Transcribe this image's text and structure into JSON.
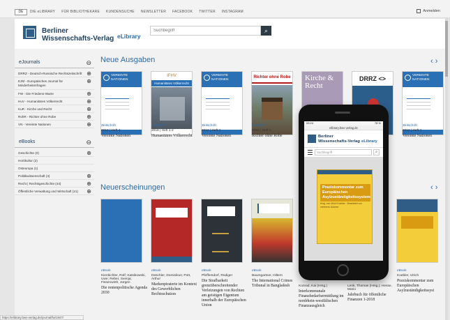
{
  "topbar": {
    "lang": "DE",
    "nav": [
      "DIE eLIBRARY",
      "FÜR BIBLIOTHEKARE",
      "KUNDENSUCHE",
      "NEWSLETTER",
      "FACEBOOK",
      "TWITTER",
      "INSTAGRAM"
    ],
    "login": "Anmelden"
  },
  "header": {
    "brand_line1": "Berliner",
    "brand_line2": "Wissenschafts-Verlag",
    "elibrary": "eLibrary",
    "search_placeholder": "Suchbegriff"
  },
  "sidebar": {
    "ejournals_title": "eJournals",
    "ejournals": [
      "DRRZ - Deutsch-Russische Rechtszeitschrift",
      "EJM - Europäisches Journal für Minderheitenfragen",
      "FW - Die Friedens-Warte",
      "HuV - Humanitäres Völkerrecht",
      "KuR - Kirche und Recht",
      "RohR - Richter ohne Robe",
      "VN - Vereinte Nationen"
    ],
    "ebooks_title": "eBooks",
    "ebooks": [
      "Geschichte (0)",
      "Hortikultur (2)",
      "Osteuropa (1)",
      "Politikwissenschaft (4)",
      "Recht | Rechtsgeschichte (44)",
      "Öffentliche Verwaltung und Wirtschaft (21)"
    ]
  },
  "neue_ausgaben": {
    "title": "Neue Ausgaben",
    "items": [
      {
        "kind": "Zeitschrift",
        "issue": "2018 | Heft 4",
        "name": "Vereinte Nationen"
      },
      {
        "kind": "Zeitschrift",
        "issue": "2018 | Heft 1-2",
        "name": "Humanitäres Völkerrecht"
      },
      {
        "kind": "Zeitschrift",
        "issue": "2018 | Heft 1",
        "name": "Vereinte Nationen"
      },
      {
        "kind": "Zeitschrift",
        "issue": "2018 | Heft 1",
        "name": "Richter ohne Robe"
      },
      {
        "kind": "Zeitschrift",
        "issue": "2018 | Heft 1",
        "name": "Vereinte Nationen"
      }
    ]
  },
  "neuerscheinungen": {
    "title": "Neuerscheinungen",
    "items": [
      {
        "kind": "eBook",
        "authors": "Kienbichler, Rolf; Katsikowski, Uwe; Reber, Svenja; Fissenwirth, Jürgen",
        "name": "Die rentenpolitische Agenda 2030"
      },
      {
        "kind": "eBook",
        "authors": "Deschler, Dominikus; Pott, Arthur",
        "name": "Markenpiraterie im Kontext des Gewerblichen Rechtsschutzes"
      },
      {
        "kind": "eBook",
        "authors": "Pfeffersdorf, Rüdiger",
        "name": "Die Strafbarkeit grenzüberschreitender Verletzungen von Rechten am geistigen Eigentum innerhalb der Europäischen Union"
      },
      {
        "kind": "eBook",
        "authors": "Baumgartner, Hiltern",
        "name": "The International Crimes Tribunal in Bangladesh"
      },
      {
        "kind": "eBook",
        "authors": "Konrad, Kai (Hrsg.)",
        "name": "Interkommunale Finanzbedarfsermittlung im nordrhein-westfälischen Finanzausgleich"
      },
      {
        "kind": "eBook",
        "authors": "Lenk, Thomas (Hrsg.); Hesse, Mario",
        "name": "Jahrbuch für öffentliche Finanzen 1-2018"
      },
      {
        "kind": "eBook",
        "authors": "Koebler, Ulrich",
        "name": "Praxiskommentar zum Europäischen Asylzuständigkeitssyst"
      }
    ]
  },
  "arrows": "‹ ›",
  "covers": {
    "un_line1": "VEREINTE",
    "un_line2": "NATIONEN",
    "ifhv": "IFHV",
    "ifhv_sub": "Humanitäres Völkerrecht",
    "richter": "Richter ohne Robe",
    "kirche": "Kirche & Recht",
    "drrz": "DRRZ <>"
  },
  "phone": {
    "time": "09:24",
    "battery": "78 %",
    "url": "elibrary.bwv-verlag.de",
    "brand_line1": "Berliner",
    "brand_line2": "Wissenschafts-Verlag",
    "elibrary": "eLibrary",
    "search_placeholder": "Suchbegriff",
    "book_title": "Praxiskommentar zum Europäischen Asylzuständigkeitssystem",
    "book_authors": "Hrsg. von Ulrich Koebler · Bearbeitet von mehreren Autoren"
  },
  "status_url": "https://elibrary.bwv-verlag.de/journal/fw/1947/"
}
